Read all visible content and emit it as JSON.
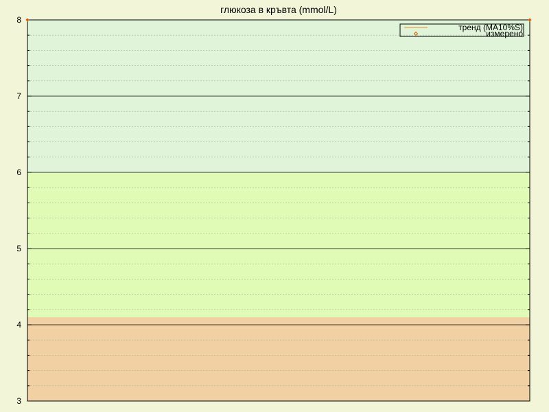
{
  "chart_data": {
    "type": "line",
    "title": "глюкоза в кръвта (mmol/L)",
    "xlabel": "",
    "ylabel": "",
    "ylim": [
      3,
      8
    ],
    "y_ticks": [
      "3",
      "4",
      "5",
      "6",
      "7",
      "8"
    ],
    "y_tick_values": [
      3,
      4,
      5,
      6,
      7,
      8
    ],
    "minor_y_step": 0.2,
    "grid": true,
    "legend_position": "top-right",
    "bands": [
      {
        "name": "low",
        "from": 3,
        "to": 4.1,
        "color": "#f1d0a3"
      },
      {
        "name": "normal",
        "from": 4.1,
        "to": 6,
        "color": "#e0fbb6"
      },
      {
        "name": "high",
        "from": 6,
        "to": 8,
        "color": "#e0f4da"
      }
    ],
    "series": [
      {
        "name": "тренд (MA10%S)",
        "kind": "line",
        "color": "#f08c1e",
        "values": []
      },
      {
        "name": "измерено",
        "kind": "points",
        "color": "#e06000",
        "values": []
      }
    ],
    "edge_markers": [
      {
        "side": "left",
        "y": 8
      },
      {
        "side": "right",
        "y": 8
      }
    ]
  },
  "colors": {
    "background": "#f2f5d8",
    "axis": "#000000",
    "major_grid": "#000000",
    "minor_grid": "#a8b49a"
  }
}
